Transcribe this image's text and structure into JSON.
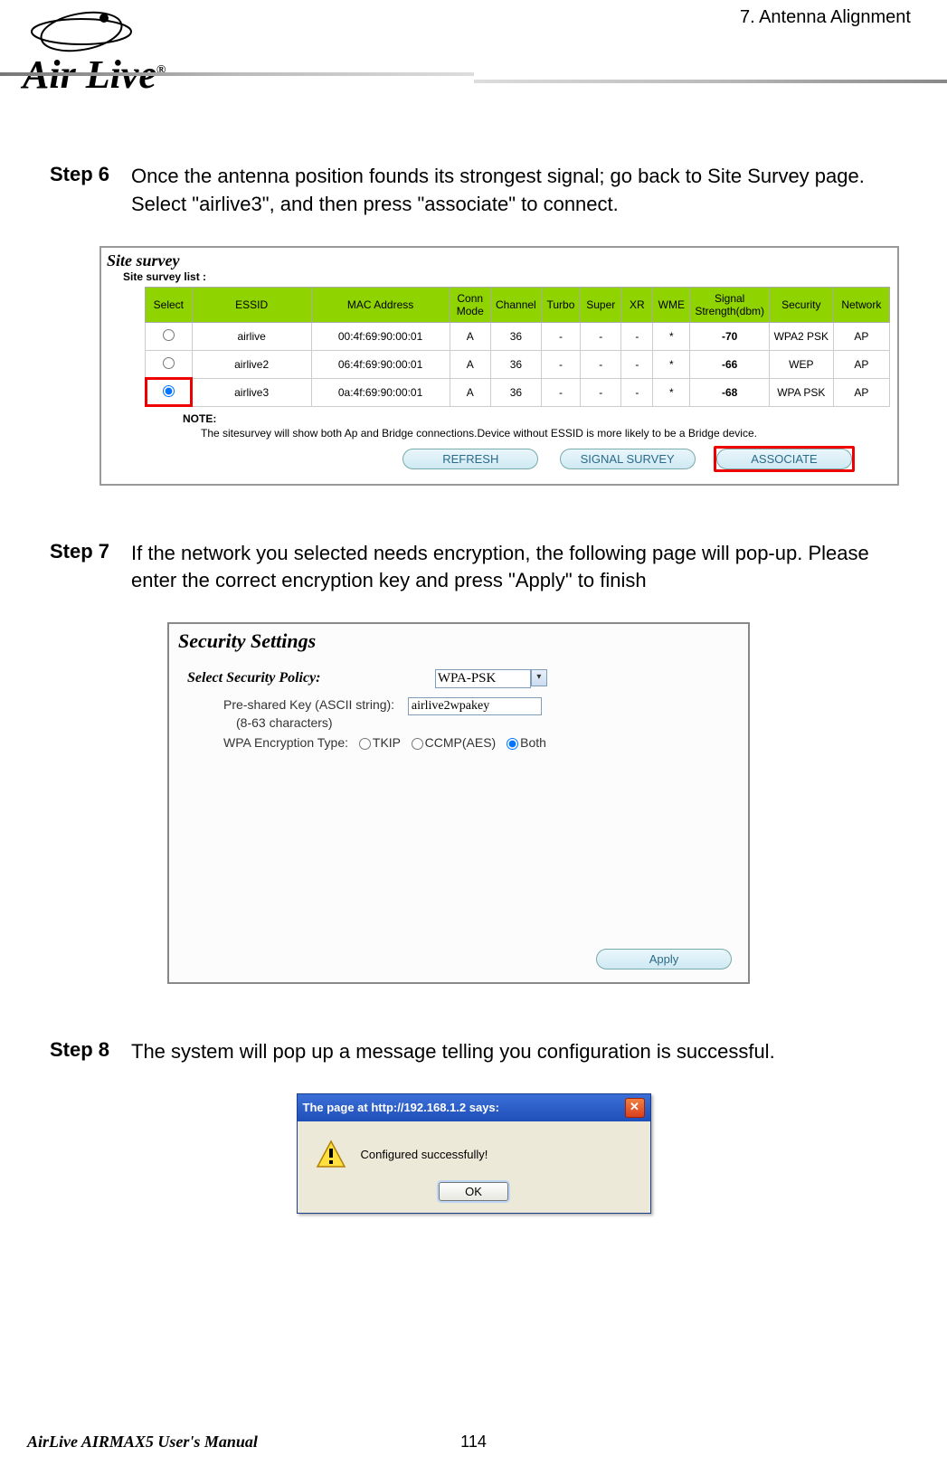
{
  "header": {
    "section_title": "7.  Antenna  Alignment",
    "logo_text": "Air Live",
    "logo_reg": "®"
  },
  "step6": {
    "label": "Step 6",
    "text": "Once the antenna position founds its strongest signal; go back to Site Survey page.    Select \"airlive3\", and then press \"associate\" to connect."
  },
  "fig1": {
    "title": "Site survey",
    "subtitle": "Site survey list :",
    "headers": [
      "Select",
      "ESSID",
      "MAC Address",
      "Conn Mode",
      "Channel",
      "Turbo",
      "Super",
      "XR",
      "WME",
      "Signal Strength(dbm)",
      "Security",
      "Network"
    ],
    "rows": [
      {
        "selected": false,
        "essid": "airlive",
        "mac": "00:4f:69:90:00:01",
        "conn": "A",
        "ch": "36",
        "turbo": "-",
        "super": "-",
        "xr": "-",
        "wme": "*",
        "signal": "-70",
        "sec": "WPA2 PSK",
        "net": "AP"
      },
      {
        "selected": false,
        "essid": "airlive2",
        "mac": "06:4f:69:90:00:01",
        "conn": "A",
        "ch": "36",
        "turbo": "-",
        "super": "-",
        "xr": "-",
        "wme": "*",
        "signal": "-66",
        "sec": "WEP",
        "net": "AP"
      },
      {
        "selected": true,
        "essid": "airlive3",
        "mac": "0a:4f:69:90:00:01",
        "conn": "A",
        "ch": "36",
        "turbo": "-",
        "super": "-",
        "xr": "-",
        "wme": "*",
        "signal": "-68",
        "sec": "WPA PSK",
        "net": "AP"
      }
    ],
    "note_label": "NOTE:",
    "note_text": "The sitesurvey will show both Ap and Bridge connections.Device without ESSID is more likely to be a Bridge device.",
    "btn_refresh": "REFRESH",
    "btn_signal": "SIGNAL SURVEY",
    "btn_associate": "ASSOCIATE"
  },
  "step7": {
    "label": "Step 7",
    "text": "If the network you selected needs encryption, the following page will pop-up.  Please enter the correct encryption key and press \"Apply\" to finish"
  },
  "fig2": {
    "title": "Security Settings",
    "policy_label": "Select Security Policy:",
    "policy_value": "WPA-PSK",
    "psk_label": "Pre-shared Key (ASCII string):",
    "psk_value": "airlive2wpakey",
    "psk_note": "(8-63 characters)",
    "enc_label": "WPA Encryption Type:",
    "opt_tkip": "TKIP",
    "opt_ccmp": "CCMP(AES)",
    "opt_both": "Both",
    "btn_apply": "Apply"
  },
  "step8": {
    "label": "Step 8",
    "text": "The system will pop up a message telling you configuration is successful."
  },
  "fig3": {
    "title": "The page at http://192.168.1.2 says:",
    "msg": "Configured successfully!",
    "btn_ok": "OK"
  },
  "footer": {
    "manual": "AirLive AIRMAX5 User's Manual",
    "page": "114"
  }
}
